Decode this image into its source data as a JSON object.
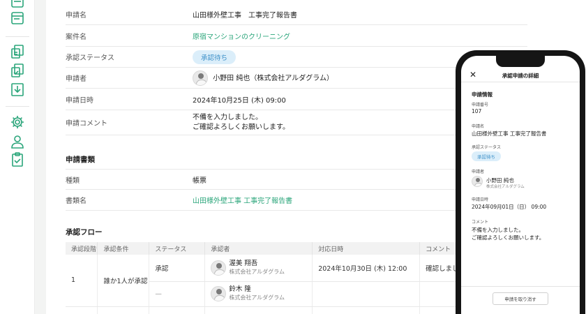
{
  "rail": {
    "icons": [
      "list-icon",
      "document-icon",
      "documents-copy-icon",
      "download-icon",
      "gear-icon",
      "user-icon",
      "clipboard-check-icon"
    ]
  },
  "details": {
    "rows": [
      {
        "label": "申請名",
        "value": "山田様外壁工事　工事完了報告書"
      },
      {
        "label": "案件名",
        "value": "原宿マンションのクリーニング"
      },
      {
        "label": "承認ステータス",
        "value": "承認待ち"
      },
      {
        "label": "申請者",
        "value": "小野田 純也（株式会社アルダグラム）"
      },
      {
        "label": "申請日時",
        "value": "2024年10月25日 (木) 09:00"
      },
      {
        "label": "申請コメント",
        "value": "不備を入力しました。",
        "value2": "ご確認よろしくお願いします。"
      }
    ]
  },
  "documents": {
    "title": "申請書類",
    "rows": [
      {
        "label": "種類",
        "value": "帳票"
      },
      {
        "label": "書類名",
        "value": "山田様外壁工事 工事完了報告書"
      }
    ]
  },
  "flow": {
    "title": "承認フロー",
    "headers": [
      "承認段階",
      "承認条件",
      "ステータス",
      "承認者",
      "対応日時",
      "コメント"
    ],
    "stage": "1",
    "condition": "誰か1人が承認",
    "approvers": [
      {
        "status": "承認",
        "name": "渥美 翔吾",
        "company": "株式会社アルダグラム",
        "datetime": "2024年10月30日 (木)  12:00",
        "comment": "確認しました"
      },
      {
        "status": "—",
        "name": "鈴木 隆",
        "company": "株式会社アルダグラム",
        "datetime": "",
        "comment": ""
      }
    ]
  },
  "phone": {
    "title": "承認申請の詳細",
    "section": "申請情報",
    "number_label": "申請番号",
    "number": "107",
    "name_label": "申請名",
    "name": "山田様外壁工事 工事完了報告書",
    "status_label": "承認ステータス",
    "status": "承認待ち",
    "applicant_label": "申請者",
    "applicant_name": "小野田 純也",
    "applicant_company": "株式会社アルダグラム",
    "date_label": "申請日時",
    "date": "2024年09月01日（日） 09:00",
    "comment_label": "コメント",
    "comment_line1": "不備を入力しました。",
    "comment_line2": "ご確認よろしくお願いします。",
    "cancel_label": "申請を取り消す"
  },
  "colors": {
    "accent": "#2aa57a",
    "badge_bg": "#dbeefa",
    "badge_text": "#3b8fc8"
  }
}
